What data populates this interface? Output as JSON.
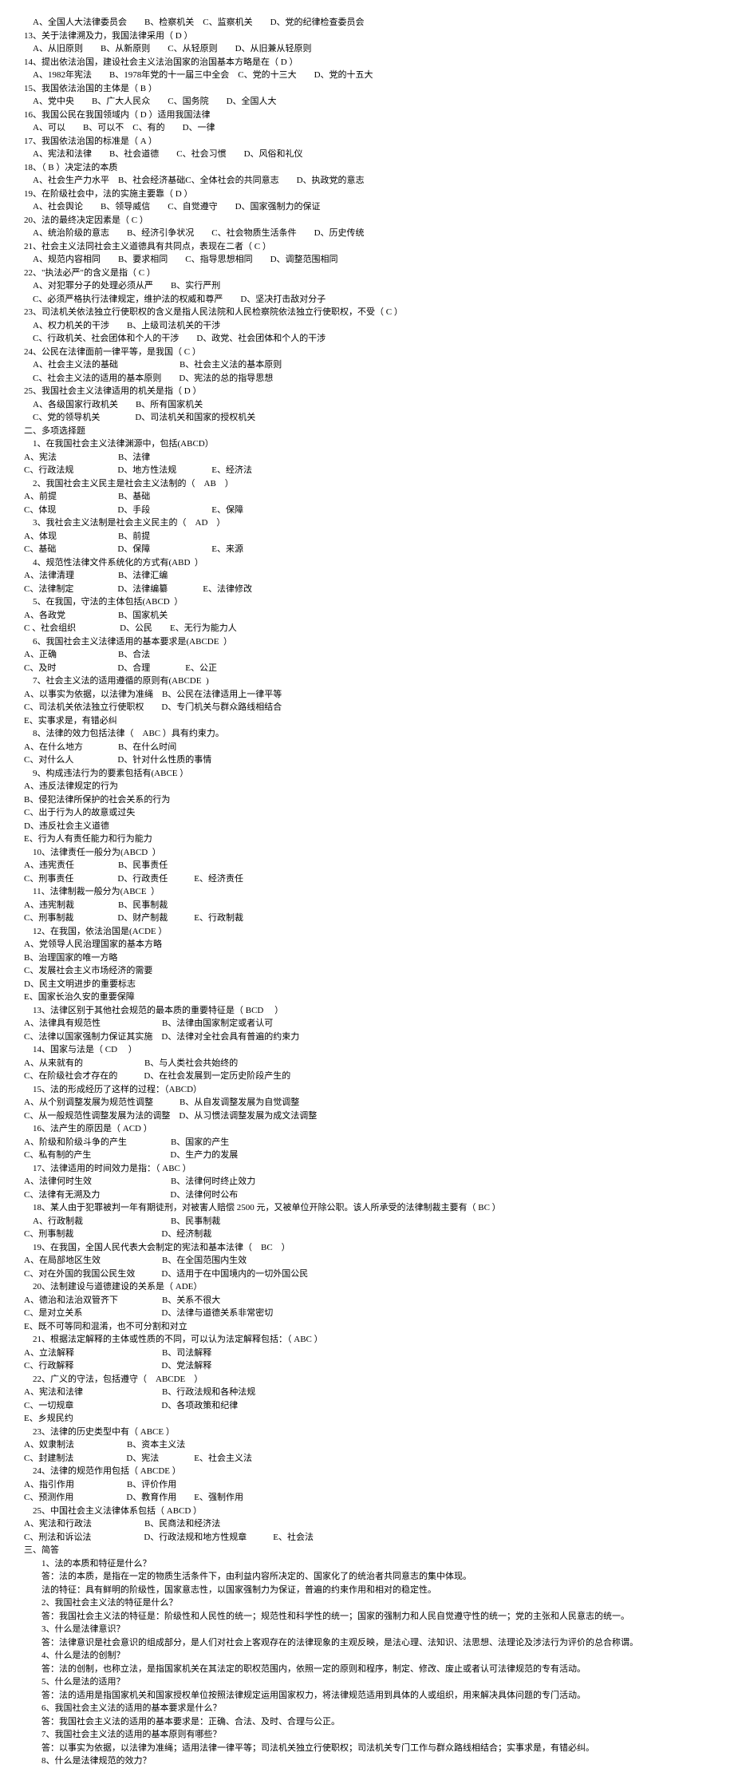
{
  "lines": [
    "　A、全国人大法律委员会　　B、检察机关　C、监察机关　　D、党的纪律检查委员会",
    "13、关于法律溯及力，我国法律采用（ D ）",
    "　A、从旧原则　　B、从新原则　　C、从轻原则　　D、从旧兼从轻原则",
    "14、提出依法治国，建设社会主义法治国家的治国基本方略是在（ D ）",
    "　A、1982年宪法　　B、1978年党的十一届三中全会　C、党的十三大　　D、党的十五大",
    "15、我国依法治国的主体是（ B ）",
    "　A、党中央　　B、广大人民众　　C、国务院　　D、全国人大",
    "16、我国公民在我国领域内（ D ）适用我国法律",
    "　A、可以　　B、可以不　C、有的　　D、一律",
    "17、我国依法治国的标准是（ A ）",
    "　A、宪法和法律　　B、社会道德　　C、社会习惯　　D、风俗和礼仪",
    "18、（ B ）决定法的本质",
    "　A、社会生产力水平　B、社会经济基础C、全体社会的共同意志　　D、执政党的意志",
    "19、在阶级社会中，法的实施主要靠（ D ）",
    "　A、社会舆论　　B、领导威信　　C、自觉遵守　　D、国家强制力的保证",
    "20、法的最终决定因素是（ C ）",
    "　A、统治阶级的意志　　B、经济引争状况　　C、社会物质生活条件　　D、历史传统",
    "21、社会主义法同社会主义道德具有共同点，表现在二者（ C ）",
    "　A、规范内容相同　　B、要求相同　　C、指导思想相同　　D、调整范围相同",
    "22、\"执法必严\"的含义是指（ C ）",
    "　A、对犯罪分子的处理必须从严　　B、实行严刑",
    "　C、必须严格执行法律规定，维护法的权威和尊严　　D、坚决打击敌对分子",
    "23、司法机关依法独立行使职权的含义是指人民法院和人民检察院依法独立行使职权，不受（ C ）",
    "　A、权力机关的干涉　　B、上级司法机关的干涉",
    "　C、行政机关、社会团体和个人的干涉　　D、政党、社会团体和个人的干涉",
    "24、公民在法律面前一律平等，是我国（ C ）",
    "　A、社会主义法的基础　　　　　　　B、社会主义法的基本原则",
    "　C、社会主义法的适用的基本原则　　D、宪法的总的指导思想",
    "25、我国社会主义法律适用的机关是指（ D ）",
    "　A、各级国家行政机关　　B、所有国家机关",
    "　C、党的领导机关　　　　D、司法机关和国家的授权机关",
    "二、多项选择题",
    "　1、在我国社会主义法律渊源中，包括(ABCD）",
    "A、宪法　　　　　　　B、法律",
    "C、行政法规　　　　　D、地方性法规　　　　E、经济法",
    "　2、我国社会主义民主是社会主义法制的（　AB　）",
    "A、前提　　　　　　　B、基础",
    "C、体现　　　　　　　D、手段　　　　　　　E、保障",
    "　3、我社会主义法制是社会主义民主的（　AD　）",
    "A、体现　　　　　　　B、前提",
    "C、基础　　　　　　　D、保障　　　　　　　E、来源",
    "　4、规范性法律文件系统化的方式有(ABD  ）",
    "A、法律清理　　　　　B、法律汇编",
    "C、法律制定　　　　　D、法律编纂　　　　E、法律修改",
    "　5、在我国，守法的主体包括(ABCD  ）",
    "A、各政党　　　　　　B、国家机关",
    "C 、社会组织　　　　　D、公民　　E、无行为能力人",
    "　6、我国社会主义法律适用的基本要求是(ABCDE  ）",
    "A、正确　　　　　　　B、合法",
    "C、及时　　　　　　　D、合理　　　　E、公正",
    "　7、社会主义法的适用遵循的原则有(ABCDE  )",
    "A、以事实为依据，以法律为准绳　B、公民在法律适用上一律平等",
    "C、司法机关依法独立行使职权　　D、专门机关与群众路线相结合",
    "E、实事求是，有错必纠",
    "　8、法律的效力包括法律（　ABC ）具有约束力。",
    "A、在什么地方　　　　B、在什么时间",
    "C、对什么人　　　　　D、针对什么性质的事情",
    "　9、构成违法行为的要素包括有(ABCE ）",
    "A、违反法律规定的行为",
    "B、侵犯法律所保护的社会关系的行为",
    "C、出于行为人的故意或过失",
    "D、违反社会主义道德",
    "E、行为人有责任能力和行为能力",
    "　10、法律责任一般分为(ABCD  ）",
    "A、违宪责任　　　　　B、民事责任",
    "C、刑事责任　　　　　D、行政责任　　　E、经济责任",
    "　11、法律制裁一般分为(ABCE  ）",
    "A、违宪制裁　　　　　B、民事制裁",
    "C、刑事制裁　　　　　D、财产制裁　　　E、行政制裁",
    "　12、在我国，依法治国是(ACDE ）",
    "A、党领导人民治理国家的基本方略",
    "B、治理国家的唯一方略",
    "C、发展社会主义市场经济的需要",
    "D、民主文明进步的重要标志",
    "E、国家长治久安的重要保障",
    "　13、法律区别于其他社会规范的最本质的重要特征是（ BCD 　）",
    "A、法律具有规范性　　　　　　　B、法律由国家制定或者认可",
    "C、法律以国家强制力保证其实施　D、法律对全社会具有普遍的约束力",
    "　14、国家与法是（ CD 　）",
    "A、从来就有的　　　　　　　B、与人类社会共始终的",
    "C、在阶级社会才存在的　　　D、在社会发展到一定历史阶段产生的",
    "　15、法的形成经历了这样的过程：（ABCD）",
    "A、从个别调整发展为规范性调整　　　B、从自发调整发展为自觉调整",
    "C、从一般规范性调整发展为法的调整　D、从习惯法调整发展为成文法调整",
    "　16、法产生的原因是（ ACD ）",
    "A、阶级和阶级斗争的产生　　　　　B、国家的产生",
    "C、私有制的产生　　　　　　　　　D、生产力的发展",
    "　17、法律适用的时间效力是指：（ ABC ）",
    "A、法律何时生效　　　　　　　　　B、法律何时终止效力",
    "C、法律有无溯及力　　　　　　　　D、法律何时公布",
    "　18、某人由于犯罪被判一年有期徒刑，对被害人赔偿 2500 元，又被单位开除公职。该人所承受的法律制裁主要有（ BC ）",
    "　A、行政制裁　　　　　　　　　　B、民事制裁",
    "C、刑事制裁　　　　　　　　　　D、经济制裁",
    "　19、在我国，全国人民代表大会制定的宪法和基本法律（　BC　）",
    "A、在局部地区生效　　　　　　　B、在全国范围内生效",
    "C、对在外国的我国公民生效　　　D、适用于在中国境内的一切外国公民",
    "　20、法制建设与道德建设的关系是（ ADE）",
    "A、德治和法治双管齐下　　　　　B、关系不很大",
    "C、是对立关系　　　　　　　　　D、法律与道德关系非常密切",
    "E、既不可等同和混淆，也不可分割和对立",
    "　21、根据法定解释的主体或性质的不同，可以认为法定解释包括：（ ABC ）",
    "A、立法解释　　　　　　　　　　B、司法解释",
    "C、行政解释　　　　　　　　　　D、党法解释",
    "　22、广义的守法，包括遵守（　ABCDE　）",
    "A、宪法和法律　　　　　　　　　B、行政法规和各种法规",
    "C、一切规章　　　　　　　　　　D、各项政策和纪律",
    "E、乡规民约",
    "　23、法律的历史类型中有（ ABCE ）",
    "A、奴隶制法　　　　　　B、资本主义法",
    "C、封建制法　　　　　　D、宪法　　　　E、社会主义法",
    "　24、法律的规范作用包括（ ABCDE ）",
    "A、指引作用　　　　　　B、评价作用",
    "C、预测作用　　　　　　D、教育作用　　E、强制作用",
    "　25、中国社会主义法律体系包括（ ABCD ）",
    "A、宪法和行政法　　　　　　B、民商法和经济法",
    "C、刑法和诉讼法　　　　　　D、行政法规和地方性规章　　　E、社会法",
    "三、简答",
    "　　1、法的本质和特征是什么？",
    "　　答：法的本质，是指在一定的物质生活条件下，由利益内容所决定的、国家化了的统治者共同意志的集中体现。",
    "　　法的特征：具有鲜明的阶级性，国家意志性，以国家强制力为保证，普遍的约束作用和相对的稳定性。",
    "　　2、我国社会主义法的特征是什么？",
    "　　答：我国社会主义法的特征是：阶级性和人民性的统一；规范性和科学性的统一；国家的强制力和人民自觉遵守性的统一；党的主张和人民意志的统一。",
    "　　3、什么是法律意识？",
    "　　答：法律意识是社会意识的组成部分，是人们对社会上客观存在的法律现象的主观反映，是法心理、法知识、法思想、法理论及涉法行为评价的总合称谓。",
    "　　4、什么是法的创制？",
    "　　答：法的创制，也称立法，是指国家机关在其法定的职权范围内，依照一定的原则和程序，制定、修改、废止或者认可法律规范的专有活动。",
    "　　5、什么是法的适用？",
    "　　答：法的适用是指国家机关和国家授权单位按照法律规定运用国家权力，将法律规范适用到具体的人或组织，用来解决具体问题的专门活动。",
    "　　6、我国社会主义法的适用的基本要求是什么？",
    "　　答：我国社会主义法的适用的基本要求是：正确、合法、及时、合理与公正。",
    "　　7、我国社会主义法的适用的基本原则有哪些？",
    "　　答：以事实为依据，以法律为准绳；适用法律一律平等；司法机关独立行使职权；司法机关专门工作与群众路线相结合；实事求是，有错必纠。",
    "　　8、什么是法律规范的效力？"
  ]
}
